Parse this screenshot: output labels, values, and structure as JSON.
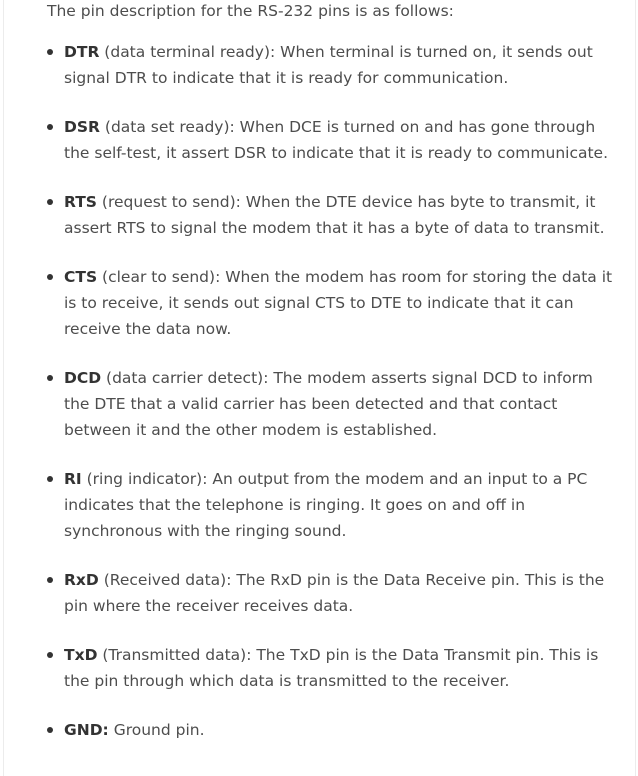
{
  "intro": "The pin description for the RS-232 pins is as follows:",
  "pins": [
    {
      "term": "DTR",
      "text": " (data terminal ready): When terminal is turned on, it sends out signal DTR to indicate that it is ready for communication."
    },
    {
      "term": "DSR",
      "text": " (data set ready): When DCE is turned on and has gone through the self-test, it assert DSR to indicate that it is ready to communicate."
    },
    {
      "term": "RTS",
      "text": " (request to send): When the DTE device has byte to transmit, it assert RTS to signal the modem that it has a byte of data to transmit."
    },
    {
      "term": "CTS",
      "text": " (clear to send): When the modem has room for storing the data it is to receive, it sends out signal CTS to DTE to indicate that it can receive the data now."
    },
    {
      "term": "DCD",
      "text": " (data carrier detect): The modem asserts signal DCD to inform the DTE that a valid carrier has been detected and that contact between it and the other modem is established."
    },
    {
      "term": "RI",
      "text": " (ring indicator): An output from the modem and an input to a PC indicates that the telephone is ringing. It goes on and off in synchronous with the ringing sound."
    },
    {
      "term": "RxD",
      "text": " (Received data): The RxD pin is the Data Receive pin. This is the pin where the receiver receives data."
    },
    {
      "term": "TxD",
      "text": " (Transmitted data): The TxD pin is the Data Transmit pin. This is the pin through which data is transmitted to the receiver."
    },
    {
      "term": "GND:",
      "text": " Ground pin."
    }
  ]
}
